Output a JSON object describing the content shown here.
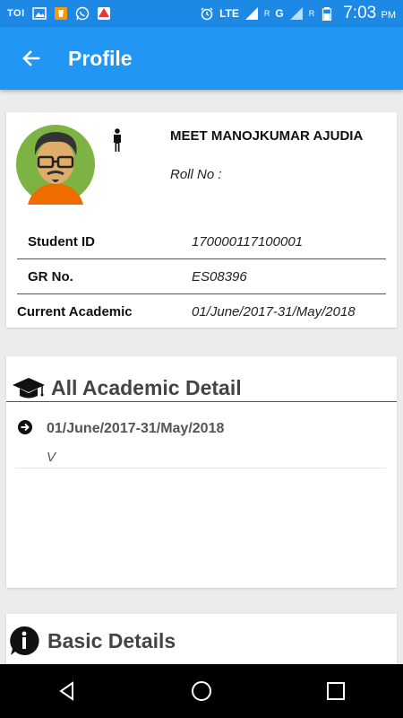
{
  "status_bar": {
    "carrier_label": "TOI",
    "network_label": "LTE",
    "roaming_1": "R",
    "network_2": "G",
    "roaming_2": "R",
    "time": "7:03",
    "ampm": "PM"
  },
  "appbar": {
    "title": "Profile",
    "icons": {
      "back": "arrow-left-icon"
    }
  },
  "profile": {
    "name": "MEET MANOJKUMAR AJUDIA",
    "roll_label": "Roll No :",
    "roll_value": "",
    "gender_icon": "male-icon",
    "fields": [
      {
        "label": "Student ID",
        "value": "170000117100001"
      },
      {
        "label": "GR No.",
        "value": "ES08396"
      },
      {
        "label": "Current Academic",
        "value": "01/June/2017-31/May/2018"
      }
    ]
  },
  "academic": {
    "title": "All Academic Detail",
    "icon": "graduation-cap-icon",
    "items": [
      {
        "period": "01/June/2017-31/May/2018",
        "standard": "V"
      }
    ]
  },
  "basic": {
    "title": "Basic Details",
    "icon": "info-icon"
  },
  "colors": {
    "primary": "#2196f3",
    "status_bar": "#1e88e5",
    "background": "#ececec"
  }
}
